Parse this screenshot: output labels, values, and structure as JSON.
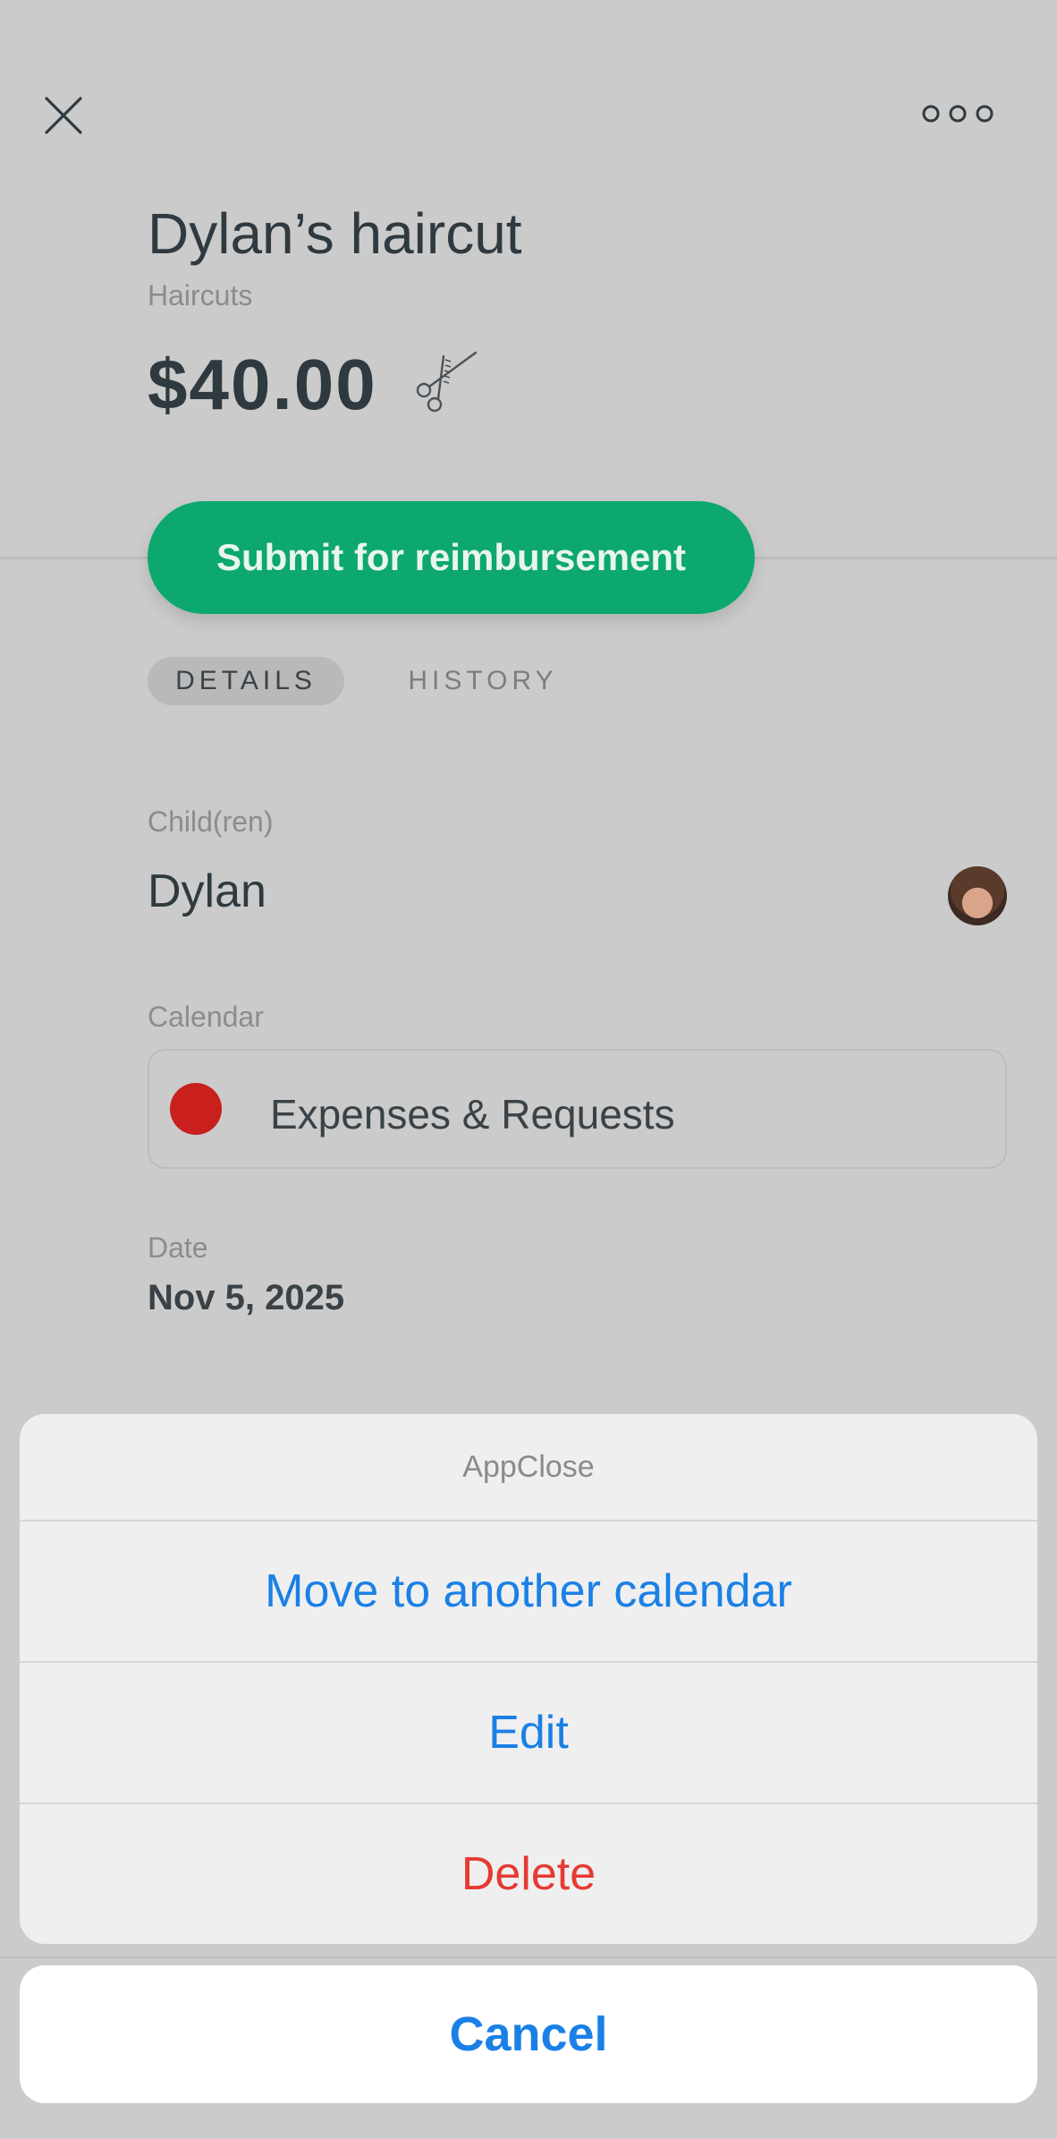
{
  "header": {
    "title": "Dylan’s haircut",
    "subtitle": "Haircuts",
    "amount": "$40.00"
  },
  "icons": {
    "close": "close-icon",
    "more": "more-icon",
    "category": "scissors-icon"
  },
  "actions": {
    "submit_label": "Submit for reimbursement"
  },
  "tabs": [
    {
      "label": "DETAILS",
      "active": true
    },
    {
      "label": "HISTORY",
      "active": false
    }
  ],
  "details": {
    "children_label": "Child(ren)",
    "child_name": "Dylan",
    "calendar_label": "Calendar",
    "calendar_name": "Expenses & Requests",
    "calendar_color": "#c9201e",
    "date_label": "Date",
    "date_value": "Nov 5, 2025"
  },
  "action_sheet": {
    "title": "AppClose",
    "items": [
      {
        "label": "Move to another calendar",
        "color": "#1a80e6"
      },
      {
        "label": "Edit",
        "color": "#1a80e6"
      },
      {
        "label": "Delete",
        "color": "#e53a33"
      }
    ],
    "cancel_label": "Cancel"
  },
  "colors": {
    "accent_green": "#0ca86d",
    "link_blue": "#1a80e6",
    "destructive_red": "#e53a33"
  }
}
